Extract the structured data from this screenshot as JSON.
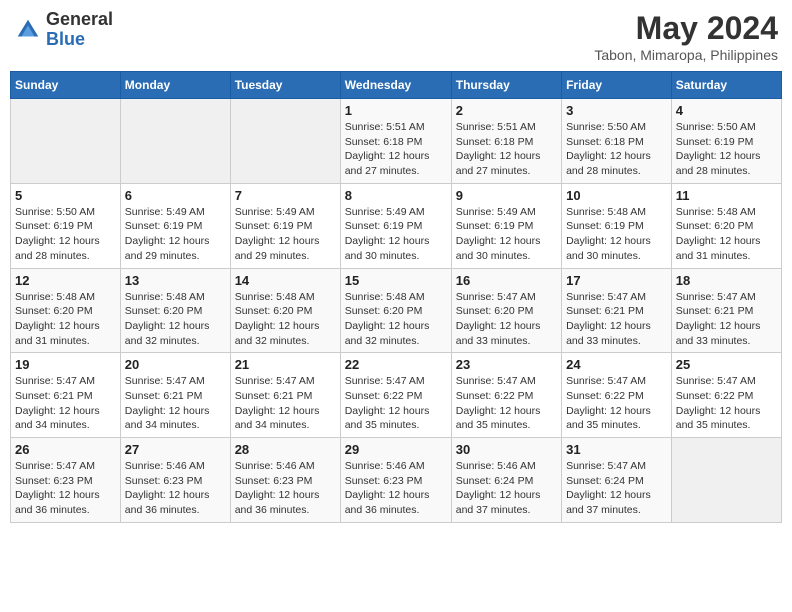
{
  "header": {
    "logo": {
      "general": "General",
      "blue": "Blue"
    },
    "title": "May 2024",
    "location": "Tabon, Mimaropa, Philippines"
  },
  "days_of_week": [
    "Sunday",
    "Monday",
    "Tuesday",
    "Wednesday",
    "Thursday",
    "Friday",
    "Saturday"
  ],
  "weeks": [
    [
      {
        "day": "",
        "info": ""
      },
      {
        "day": "",
        "info": ""
      },
      {
        "day": "",
        "info": ""
      },
      {
        "day": "1",
        "info": "Sunrise: 5:51 AM\nSunset: 6:18 PM\nDaylight: 12 hours and 27 minutes."
      },
      {
        "day": "2",
        "info": "Sunrise: 5:51 AM\nSunset: 6:18 PM\nDaylight: 12 hours and 27 minutes."
      },
      {
        "day": "3",
        "info": "Sunrise: 5:50 AM\nSunset: 6:18 PM\nDaylight: 12 hours and 28 minutes."
      },
      {
        "day": "4",
        "info": "Sunrise: 5:50 AM\nSunset: 6:19 PM\nDaylight: 12 hours and 28 minutes."
      }
    ],
    [
      {
        "day": "5",
        "info": "Sunrise: 5:50 AM\nSunset: 6:19 PM\nDaylight: 12 hours and 28 minutes."
      },
      {
        "day": "6",
        "info": "Sunrise: 5:49 AM\nSunset: 6:19 PM\nDaylight: 12 hours and 29 minutes."
      },
      {
        "day": "7",
        "info": "Sunrise: 5:49 AM\nSunset: 6:19 PM\nDaylight: 12 hours and 29 minutes."
      },
      {
        "day": "8",
        "info": "Sunrise: 5:49 AM\nSunset: 6:19 PM\nDaylight: 12 hours and 30 minutes."
      },
      {
        "day": "9",
        "info": "Sunrise: 5:49 AM\nSunset: 6:19 PM\nDaylight: 12 hours and 30 minutes."
      },
      {
        "day": "10",
        "info": "Sunrise: 5:48 AM\nSunset: 6:19 PM\nDaylight: 12 hours and 30 minutes."
      },
      {
        "day": "11",
        "info": "Sunrise: 5:48 AM\nSunset: 6:20 PM\nDaylight: 12 hours and 31 minutes."
      }
    ],
    [
      {
        "day": "12",
        "info": "Sunrise: 5:48 AM\nSunset: 6:20 PM\nDaylight: 12 hours and 31 minutes."
      },
      {
        "day": "13",
        "info": "Sunrise: 5:48 AM\nSunset: 6:20 PM\nDaylight: 12 hours and 32 minutes."
      },
      {
        "day": "14",
        "info": "Sunrise: 5:48 AM\nSunset: 6:20 PM\nDaylight: 12 hours and 32 minutes."
      },
      {
        "day": "15",
        "info": "Sunrise: 5:48 AM\nSunset: 6:20 PM\nDaylight: 12 hours and 32 minutes."
      },
      {
        "day": "16",
        "info": "Sunrise: 5:47 AM\nSunset: 6:20 PM\nDaylight: 12 hours and 33 minutes."
      },
      {
        "day": "17",
        "info": "Sunrise: 5:47 AM\nSunset: 6:21 PM\nDaylight: 12 hours and 33 minutes."
      },
      {
        "day": "18",
        "info": "Sunrise: 5:47 AM\nSunset: 6:21 PM\nDaylight: 12 hours and 33 minutes."
      }
    ],
    [
      {
        "day": "19",
        "info": "Sunrise: 5:47 AM\nSunset: 6:21 PM\nDaylight: 12 hours and 34 minutes."
      },
      {
        "day": "20",
        "info": "Sunrise: 5:47 AM\nSunset: 6:21 PM\nDaylight: 12 hours and 34 minutes."
      },
      {
        "day": "21",
        "info": "Sunrise: 5:47 AM\nSunset: 6:21 PM\nDaylight: 12 hours and 34 minutes."
      },
      {
        "day": "22",
        "info": "Sunrise: 5:47 AM\nSunset: 6:22 PM\nDaylight: 12 hours and 35 minutes."
      },
      {
        "day": "23",
        "info": "Sunrise: 5:47 AM\nSunset: 6:22 PM\nDaylight: 12 hours and 35 minutes."
      },
      {
        "day": "24",
        "info": "Sunrise: 5:47 AM\nSunset: 6:22 PM\nDaylight: 12 hours and 35 minutes."
      },
      {
        "day": "25",
        "info": "Sunrise: 5:47 AM\nSunset: 6:22 PM\nDaylight: 12 hours and 35 minutes."
      }
    ],
    [
      {
        "day": "26",
        "info": "Sunrise: 5:47 AM\nSunset: 6:23 PM\nDaylight: 12 hours and 36 minutes."
      },
      {
        "day": "27",
        "info": "Sunrise: 5:46 AM\nSunset: 6:23 PM\nDaylight: 12 hours and 36 minutes."
      },
      {
        "day": "28",
        "info": "Sunrise: 5:46 AM\nSunset: 6:23 PM\nDaylight: 12 hours and 36 minutes."
      },
      {
        "day": "29",
        "info": "Sunrise: 5:46 AM\nSunset: 6:23 PM\nDaylight: 12 hours and 36 minutes."
      },
      {
        "day": "30",
        "info": "Sunrise: 5:46 AM\nSunset: 6:24 PM\nDaylight: 12 hours and 37 minutes."
      },
      {
        "day": "31",
        "info": "Sunrise: 5:47 AM\nSunset: 6:24 PM\nDaylight: 12 hours and 37 minutes."
      },
      {
        "day": "",
        "info": ""
      }
    ]
  ]
}
